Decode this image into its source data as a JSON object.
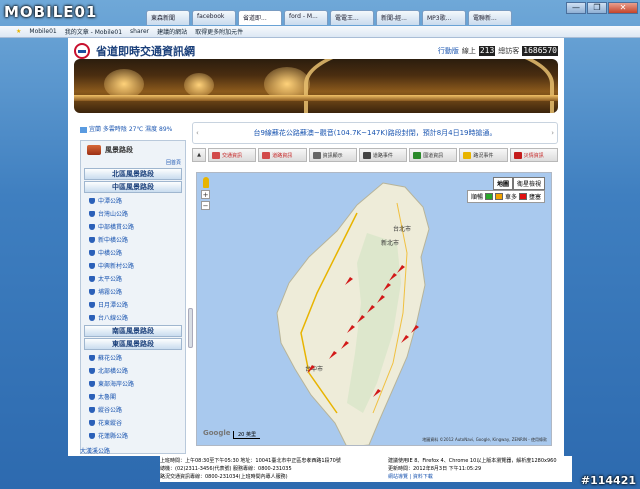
{
  "browser": {
    "logo": "MOBILE01",
    "tabs": [
      "東森新聞",
      "facebook",
      "省道即...",
      "ford - M...",
      "電電王...",
      "新聞-經...",
      "MP3歌...",
      "電聯新..."
    ],
    "fav_items": [
      "Mobile01",
      "我的文章 - Mobile01",
      "sharer",
      "建議的網站",
      "取得更多附加元件"
    ],
    "controls": [
      "—",
      "❐",
      "✕"
    ]
  },
  "header": {
    "title": "省道即時交通資訊網",
    "visit_label": "行動版",
    "online_label": "線上",
    "online_digits": "213",
    "total_label": "總訪客",
    "total_digits": "1686570"
  },
  "weather": {
    "text": "宜蘭 多雲時陰 27℃ 濕度 89%"
  },
  "sidebar": {
    "title": "風景路段",
    "sub": "回首頁",
    "regions": {
      "north": "北區風景路段",
      "central": "中區風景路段",
      "south": "南區風景路段",
      "east": "東區風景路段"
    },
    "central_items": [
      "中潭公路",
      "台灣山公路",
      "中部橫貫公路",
      "新中橫公路",
      "中橫公路",
      "中興新村公路",
      "太平公路",
      "埔霧公路",
      "日月潭公路",
      "台八線公路"
    ],
    "east_items": [
      "蘇花公路",
      "北部橫公路",
      "東部海岸公路",
      "太魯閣",
      "縱谷公路",
      "花東縱谷",
      "花蓮縣公路"
    ],
    "bottom_items": [
      "大漢溪公路",
      "中部公路"
    ]
  },
  "news": {
    "text": "台9線蘇花公路蘇澳~觀音(104.7K~147K)路段封閉，預計8月4日19時搶通。"
  },
  "toolbar": {
    "items": [
      {
        "label": "交通資訊",
        "color": "#c41b1b"
      },
      {
        "label": "道路資訊",
        "color": "#c41b1b"
      },
      {
        "label": "資訊顯示",
        "color": "#333"
      },
      {
        "label": "道路事件",
        "color": "#333"
      },
      {
        "label": "國道資訊",
        "color": "#333"
      },
      {
        "label": "路況事件",
        "color": "#333"
      },
      {
        "label": "災情資訊",
        "color": "#c41b1b"
      }
    ]
  },
  "map": {
    "type_map": "地圖",
    "type_satellite": "衛星檢視",
    "legend_label": "壅塞",
    "legend": [
      {
        "label": "順暢",
        "color": "#2aa82a"
      },
      {
        "label": "車多",
        "color": "#f2a200"
      },
      {
        "label": "壅塞",
        "color": "#e01010"
      }
    ],
    "copyright": "地圖資料 ©2012 AutoNavi, Google, Kingway, ZENRIN - 使用條款",
    "scale": "20 英里",
    "cities": [
      "新北市",
      "台中市",
      "台北市"
    ]
  },
  "footer": {
    "address": "上班時間：上午08:30至下午05:30 地址：10041臺北市中正區忠孝西路1段70號",
    "phone": "總機：(02)2311-3456(代表號) 服務專線：0800-231035",
    "hotline": "路況交通資訊專線：0800-231034(上班時間內專人服務)",
    "browser": "建議使用IE 8、Firefox 4、Chrome 10以上版本瀏覽器，解析度1280x960",
    "updated": "更新時間：2012年8月3日 下午11:05:29",
    "links": "網站導覽 | 資料下載"
  },
  "watermark": "#114421"
}
